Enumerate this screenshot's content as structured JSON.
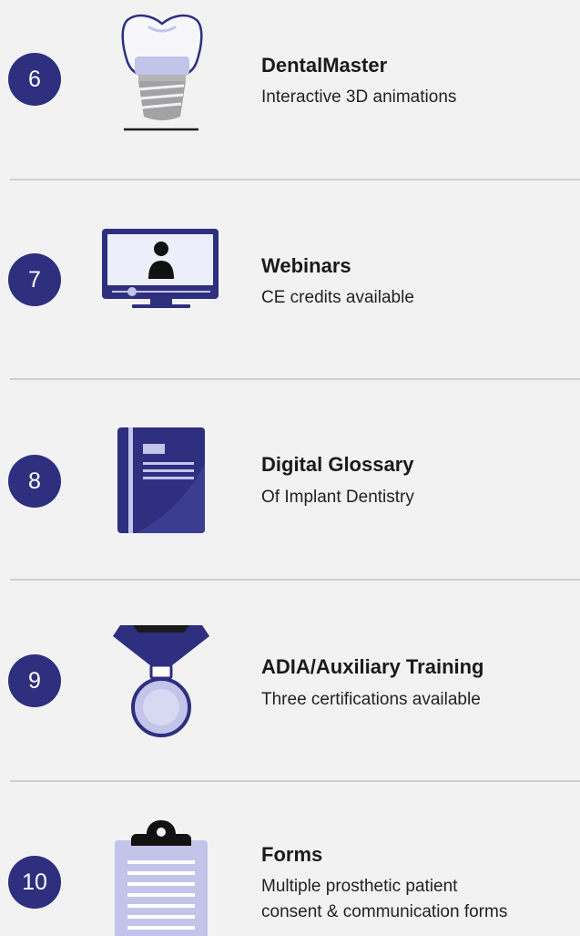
{
  "colors": {
    "navy": "#2e2f7f",
    "lavender": "#c2c4ea",
    "background": "#f2f2f2"
  },
  "items": [
    {
      "number": "6",
      "title": "DentalMaster",
      "subtitle": "Interactive 3D animations",
      "icon": "dental-implant-icon"
    },
    {
      "number": "7",
      "title": "Webinars",
      "subtitle": "CE credits available",
      "icon": "webinar-monitor-icon"
    },
    {
      "number": "8",
      "title": "Digital Glossary",
      "subtitle": "Of Implant Dentistry",
      "icon": "book-icon"
    },
    {
      "number": "9",
      "title": "ADIA/Auxiliary Training",
      "subtitle": "Three certifications available",
      "icon": "medal-icon"
    },
    {
      "number": "10",
      "title": "Forms",
      "subtitle": "Multiple prosthetic patient",
      "subtitle2": "consent & communication forms",
      "icon": "clipboard-icon"
    }
  ]
}
